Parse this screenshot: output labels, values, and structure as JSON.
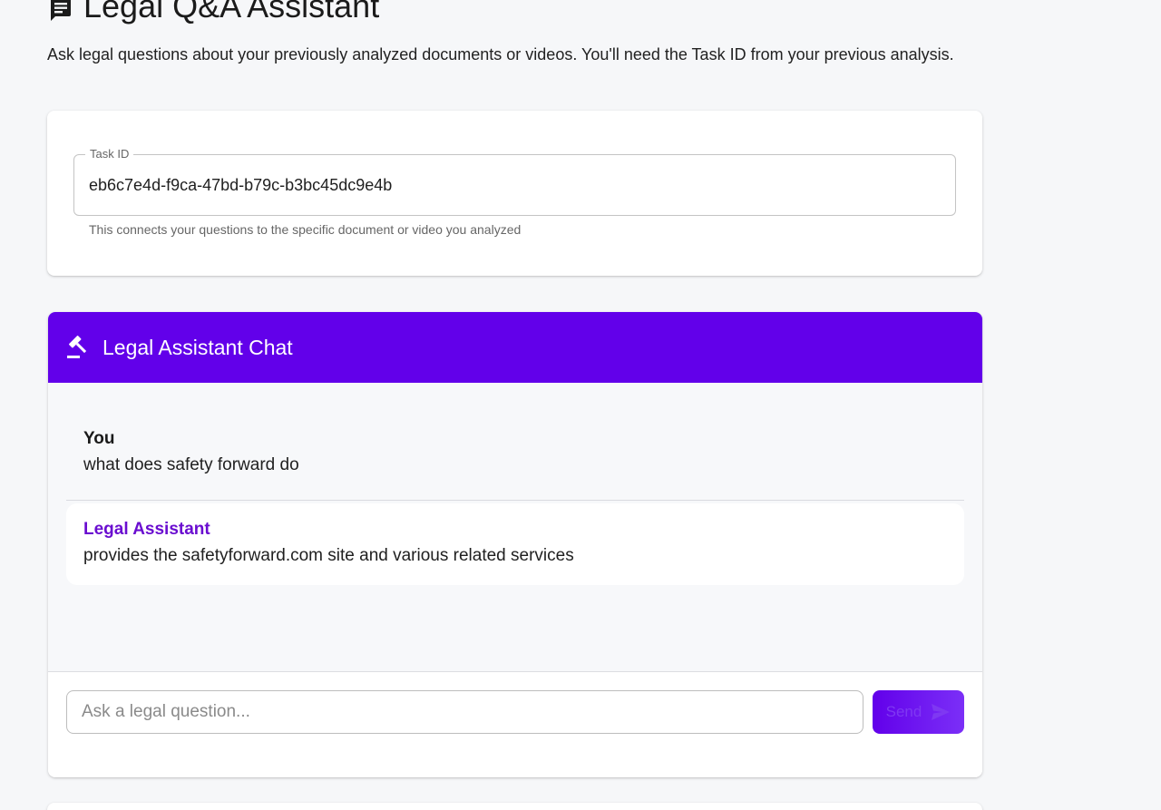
{
  "page": {
    "title": "Legal Q&A Assistant",
    "title_icon": "document-chat-icon",
    "description": "Ask legal questions about your previously analyzed documents or videos. You'll need the Task ID from your previous analysis."
  },
  "task": {
    "label": "Task ID",
    "value": "eb6c7e4d-f9ca-47bd-b79c-b3bc45dc9e4b",
    "helper": "This connects your questions to the specific document or video you analyzed"
  },
  "chat": {
    "header_title": "Legal Assistant Chat",
    "header_icon": "gavel-icon",
    "header_color": "#6200ea",
    "messages": [
      {
        "sender": "You",
        "text": "what does safety forward do"
      },
      {
        "sender": "Legal Assistant",
        "text": "provides the safetyforward.com site and various related services"
      }
    ],
    "input_placeholder": "Ask a legal question...",
    "send_label": "Send",
    "send_icon": "send-icon"
  }
}
